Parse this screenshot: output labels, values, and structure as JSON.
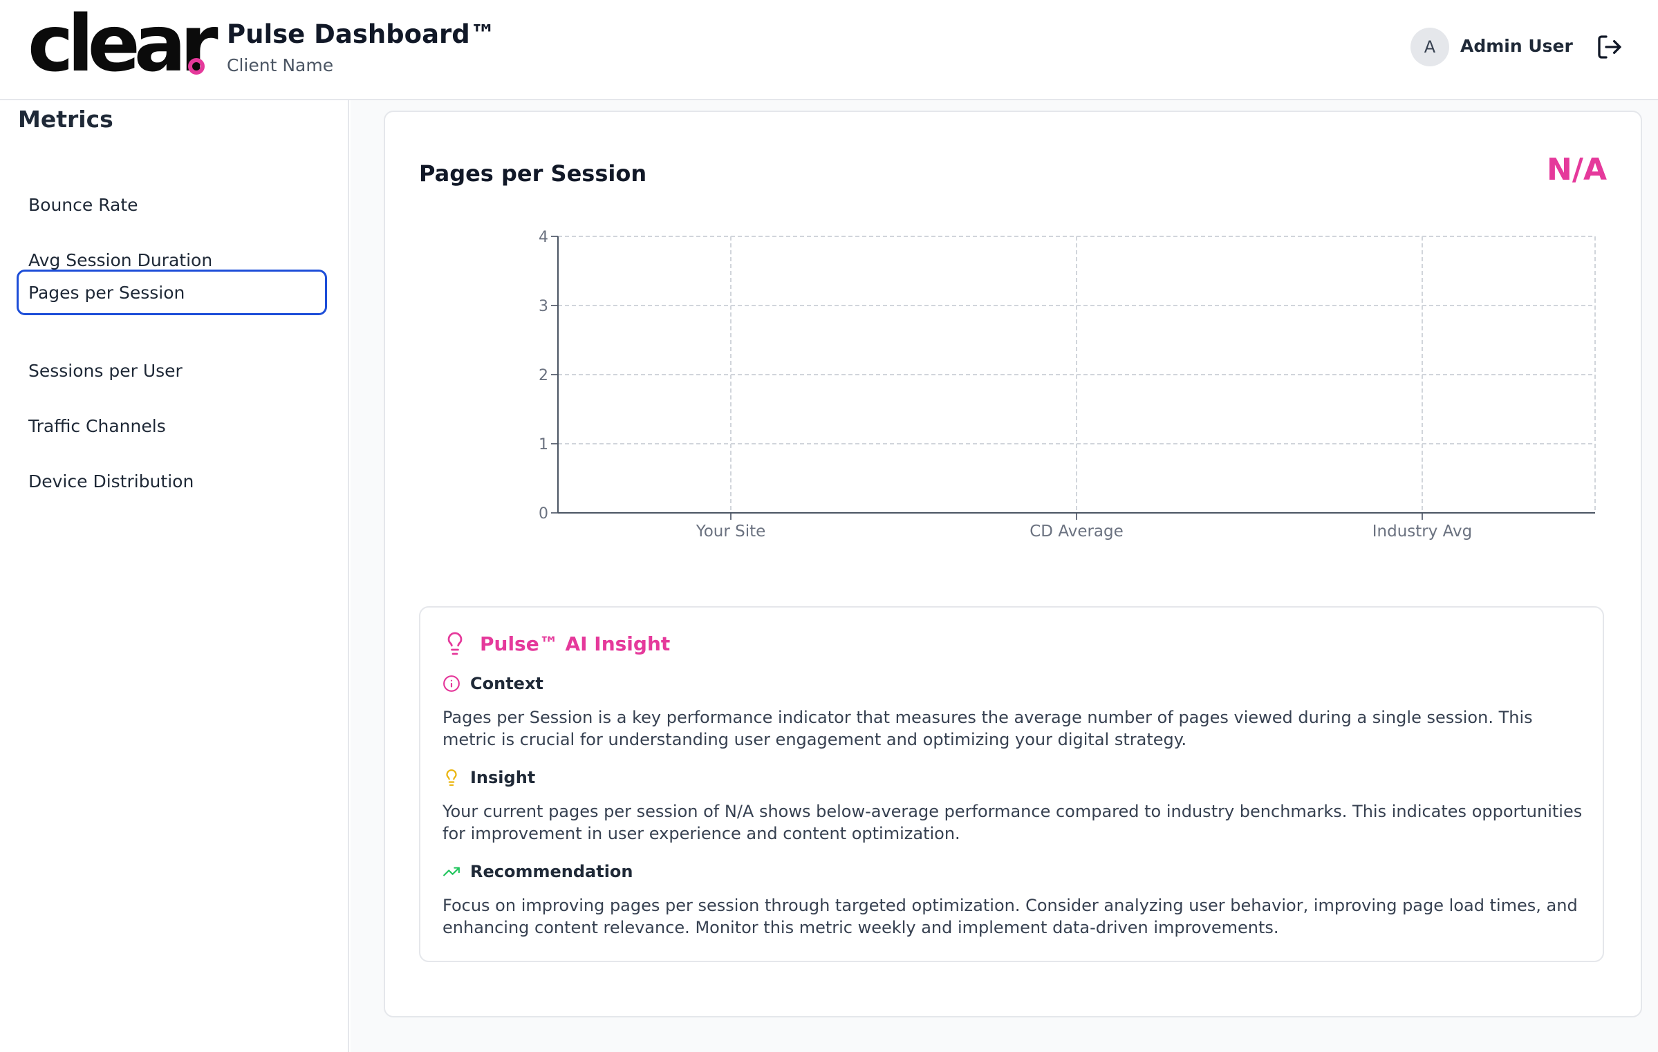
{
  "header": {
    "logo_text": "clear",
    "title": "Pulse Dashboard™",
    "client": "Client Name",
    "avatar_initial": "A",
    "user_name": "Admin User"
  },
  "sidebar": {
    "title": "Metrics",
    "items": [
      {
        "label": "Bounce Rate"
      },
      {
        "label": "Avg Session Duration"
      },
      {
        "label": "Pages per Session",
        "active": true
      },
      {
        "label": "Sessions per User"
      },
      {
        "label": "Traffic Channels"
      },
      {
        "label": "Device Distribution"
      }
    ]
  },
  "card": {
    "title": "Pages per Session",
    "value": "N/A"
  },
  "chart_data": {
    "type": "bar",
    "categories": [
      "Your Site",
      "CD Average",
      "Industry Avg"
    ],
    "values": [
      null,
      null,
      null
    ],
    "yticks": [
      "0",
      "1",
      "2",
      "3",
      "4"
    ],
    "ylim": [
      0,
      4
    ],
    "grid": true
  },
  "insight": {
    "title": "Pulse™ AI Insight",
    "sections": [
      {
        "title": "Context",
        "icon": "info-circle-icon",
        "text": "Pages per Session is a key performance indicator that measures the average number of pages viewed during a single session. This metric is crucial for understanding user engagement and optimizing your digital strategy."
      },
      {
        "title": "Insight",
        "icon": "lightbulb-icon",
        "text": "Your current pages per session of N/A shows below-average performance compared to industry benchmarks. This indicates opportunities for improvement in user experience and content optimization."
      },
      {
        "title": "Recommendation",
        "icon": "trending-up-icon",
        "text": "Focus on improving pages per session through targeted optimization. Consider analyzing user behavior, improving page load times, and enhancing content relevance. Monitor this metric weekly and implement data-driven improvements."
      }
    ]
  },
  "colors": {
    "accent": "#e5399b",
    "active_border": "#1d4ed8",
    "insight_yellow": "#eab308",
    "trend_green": "#22c55e"
  }
}
